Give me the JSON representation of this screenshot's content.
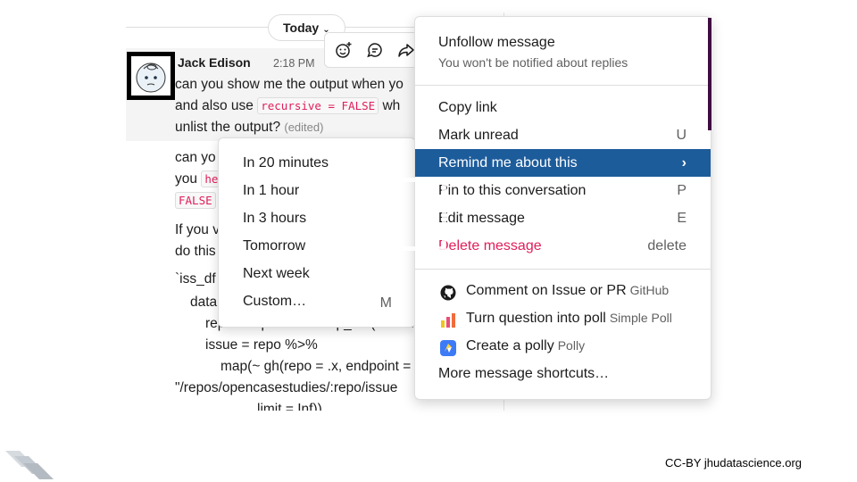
{
  "header": {
    "date_pill": "Today"
  },
  "message": {
    "author": "Jack Edison",
    "time": "2:18 PM",
    "line1": "can you show me the output when yo",
    "line2_prefix": "and also  use",
    "line2_code": "recursive = FALSE",
    "line2_suffix": "wh",
    "line3": "unlist the output?",
    "edited": "(edited)"
  },
  "reply": {
    "line1": "can yo",
    "line2_prefix": "you",
    "line2_code": "he",
    "line3_code": "FALSE",
    "line4": "If you v",
    "line5": "do this",
    "code1": "`iss_df",
    "code2": "data",
    "code3": "repo = repo %>% map_chr(~ nam",
    "code4": "issue = repo %>%",
    "code5": "map(~ gh(repo = .x, endpoint =",
    "code6": "\"/repos/opencasestudies/:repo/issue",
    "code7": "limit = Inf))"
  },
  "toolbar": {
    "icons": [
      "emoji-add-icon",
      "reply-in-thread-icon",
      "share-icon"
    ]
  },
  "remind_submenu": {
    "items": [
      {
        "label": "In 20 minutes"
      },
      {
        "label": "In 1 hour"
      },
      {
        "label": "In 3 hours"
      },
      {
        "label": "Tomorrow"
      },
      {
        "label": "Next week"
      },
      {
        "label": "Custom…",
        "shortcut": "M"
      }
    ]
  },
  "context_menu": {
    "unfollow_title": "Unfollow message",
    "unfollow_sub": "You won't be notified about replies",
    "items": [
      {
        "label": "Copy link",
        "shortcut": ""
      },
      {
        "label": "Mark unread",
        "shortcut": "U"
      },
      {
        "label": "Remind me about this",
        "shortcut": "›"
      },
      {
        "label": "Pin to this conversation",
        "shortcut": "P"
      },
      {
        "label": "Edit message",
        "shortcut": "E"
      },
      {
        "label": "Delete message",
        "shortcut": "delete"
      }
    ],
    "apps": [
      {
        "label": "Comment on Issue or PR",
        "app": "GitHub",
        "icon": "github-icon"
      },
      {
        "label": "Turn question into poll",
        "app": "Simple Poll",
        "icon": "simple-poll-icon"
      },
      {
        "label": "Create a polly",
        "app": "Polly",
        "icon": "polly-icon"
      }
    ],
    "more": "More message shortcuts…"
  },
  "footer": {
    "license": "CC-BY jhudatascience.org"
  },
  "colors": {
    "active": "#1d5c9b",
    "danger": "#e01e5a",
    "aubergine": "#3f0e40"
  }
}
